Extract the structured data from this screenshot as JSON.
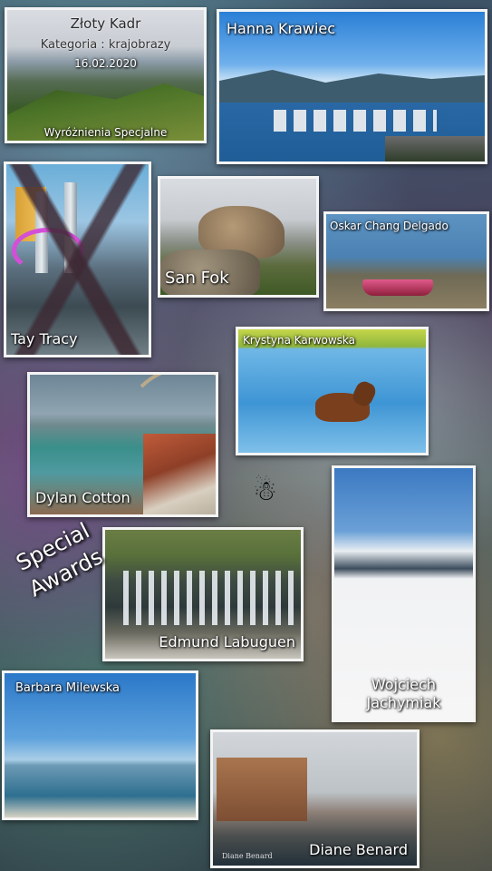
{
  "cards": {
    "zloty_kadr": {
      "title": "Złoty Kadr",
      "category": "Kategoria : krajobrazy",
      "date": "16.02.2020",
      "subtitle": "Wyróżnienia Specjalne"
    },
    "hanna": {
      "name": "Hanna Krawiec"
    },
    "tay": {
      "name": "Tay Tracy"
    },
    "san": {
      "name": "San Fok"
    },
    "oskar": {
      "name": "Oskar Chang Delgado"
    },
    "krystyna": {
      "name": "Krystyna Karwowska"
    },
    "dylan": {
      "name": "Dylan Cotton"
    },
    "edmund": {
      "name": "Edmund Labuguen"
    },
    "wojciech": {
      "first": "Wojciech",
      "last": "Jachymiak"
    },
    "barbara": {
      "name": "Barbara Milewska"
    },
    "diane": {
      "name": "Diane Benard",
      "signature": "Diane Benard"
    }
  },
  "special_awards": {
    "line1": "Special",
    "line2": "Awards"
  },
  "decoration": {
    "snowman_icon": "☃"
  }
}
